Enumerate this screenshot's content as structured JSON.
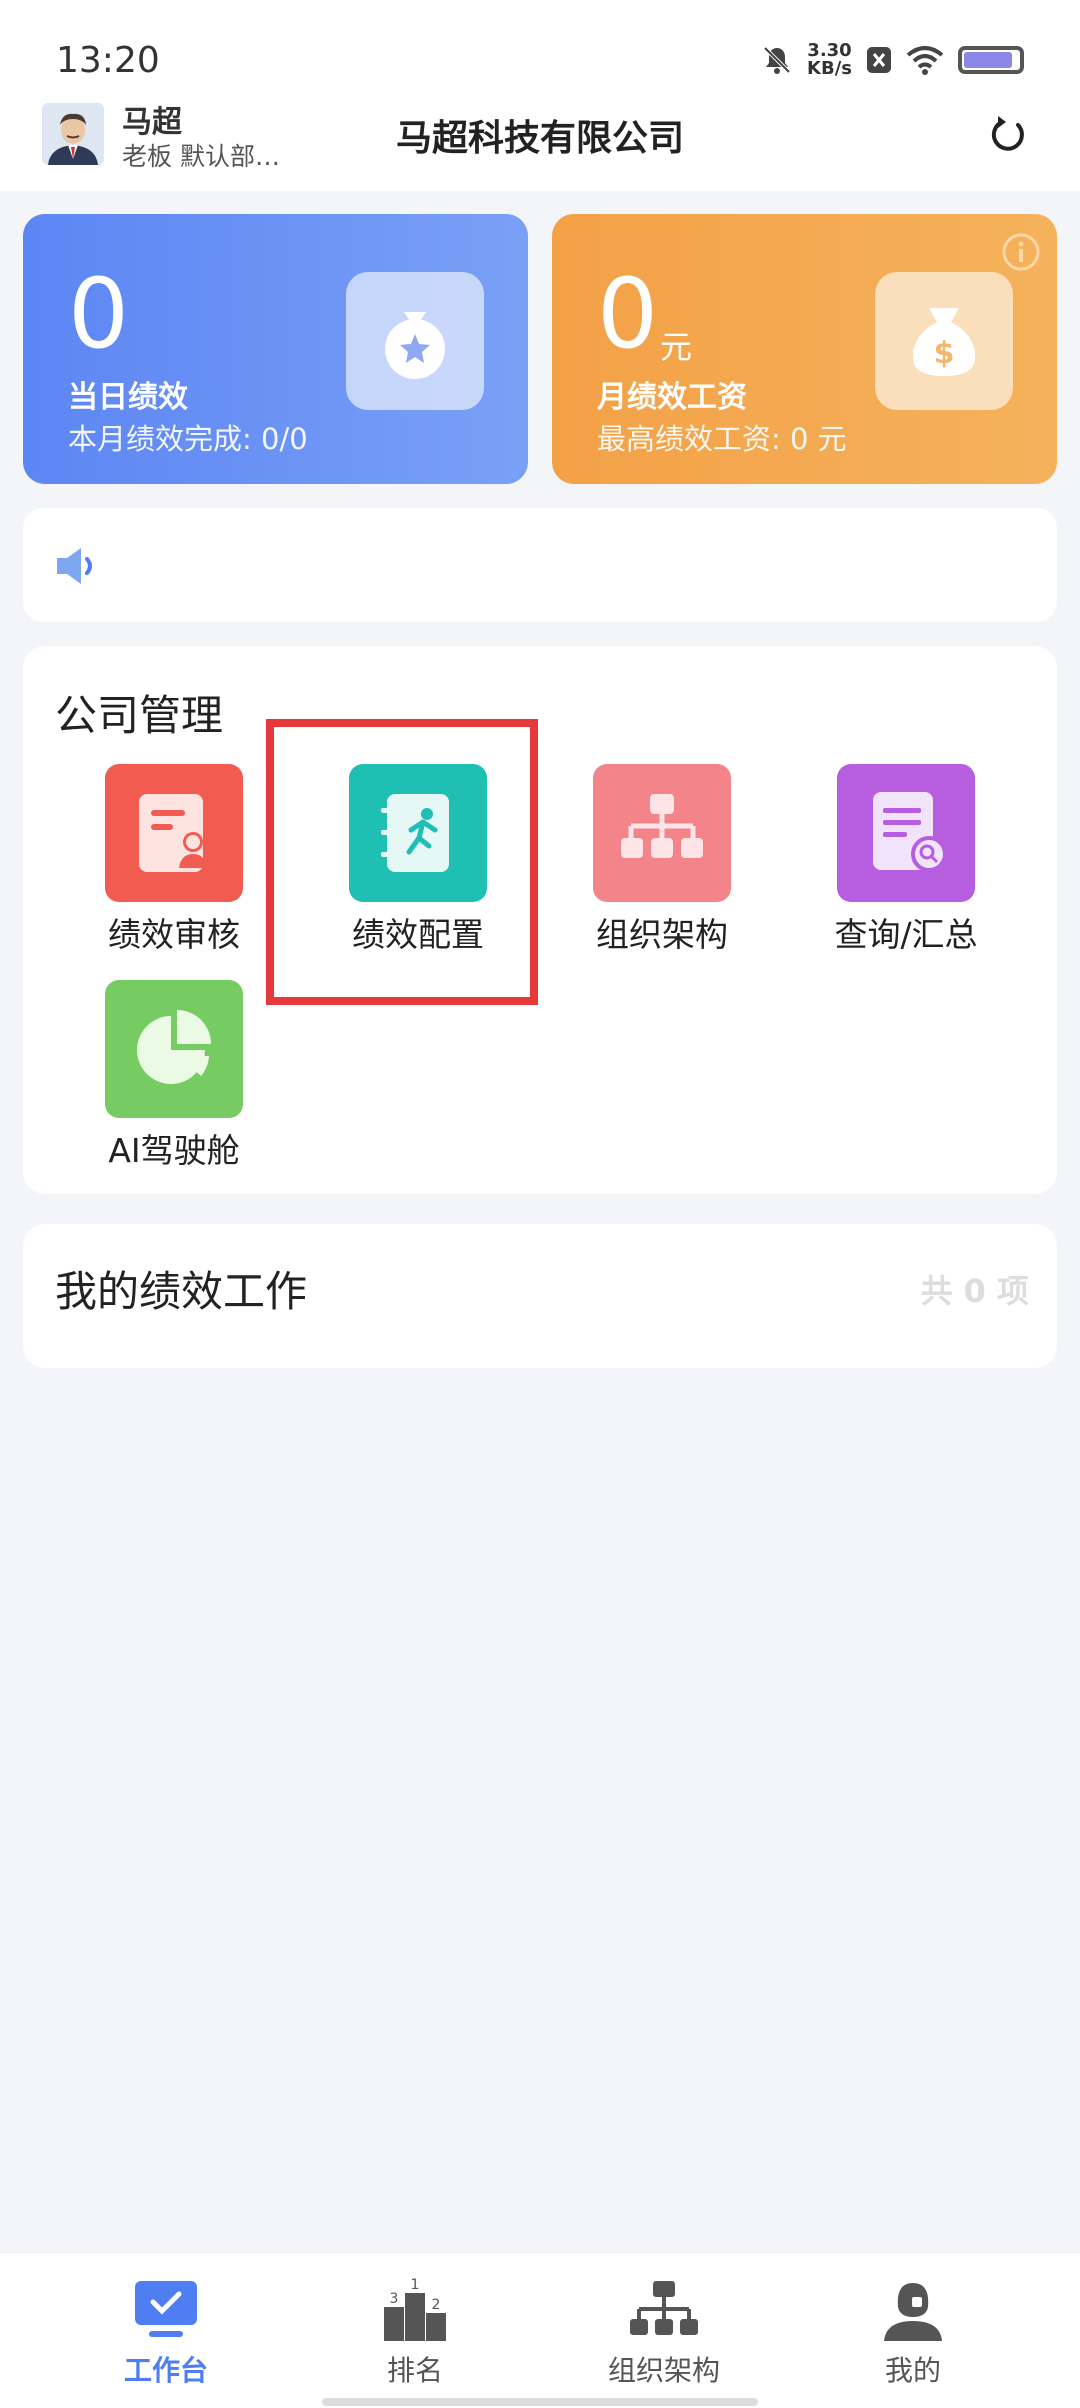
{
  "status_bar": {
    "time": "13:20",
    "net_speed": "3.30",
    "net_unit": "KB/s"
  },
  "header": {
    "user_name": "马超",
    "user_role": "老板 默认部…",
    "company": "马超科技有限公司"
  },
  "stats": {
    "daily": {
      "value": "0",
      "label": "当日绩效",
      "sub": "本月绩效完成: 0/0"
    },
    "monthly": {
      "value": "0",
      "unit": "元",
      "label": "月绩效工资",
      "sub": "最高绩效工资: 0 元"
    }
  },
  "company_mgmt": {
    "title": "公司管理",
    "tools": [
      {
        "label": "绩效审核",
        "color": "#f25b4f"
      },
      {
        "label": "绩效配置",
        "color": "#1fbfb4"
      },
      {
        "label": "组织架构",
        "color": "#f2848a"
      },
      {
        "label": "查询/汇总",
        "color": "#b65de0"
      },
      {
        "label": "AI驾驶舱",
        "color": "#76cc62"
      }
    ]
  },
  "my_work": {
    "title": "我的绩效工作",
    "count": "共 0 项"
  },
  "tabs": [
    {
      "label": "工作台",
      "active": true
    },
    {
      "label": "排名",
      "active": false
    },
    {
      "label": "组织架构",
      "active": false
    },
    {
      "label": "我的",
      "active": false
    }
  ],
  "colors": {
    "primary": "#4f7ef3",
    "highlight": "#e5393c"
  }
}
